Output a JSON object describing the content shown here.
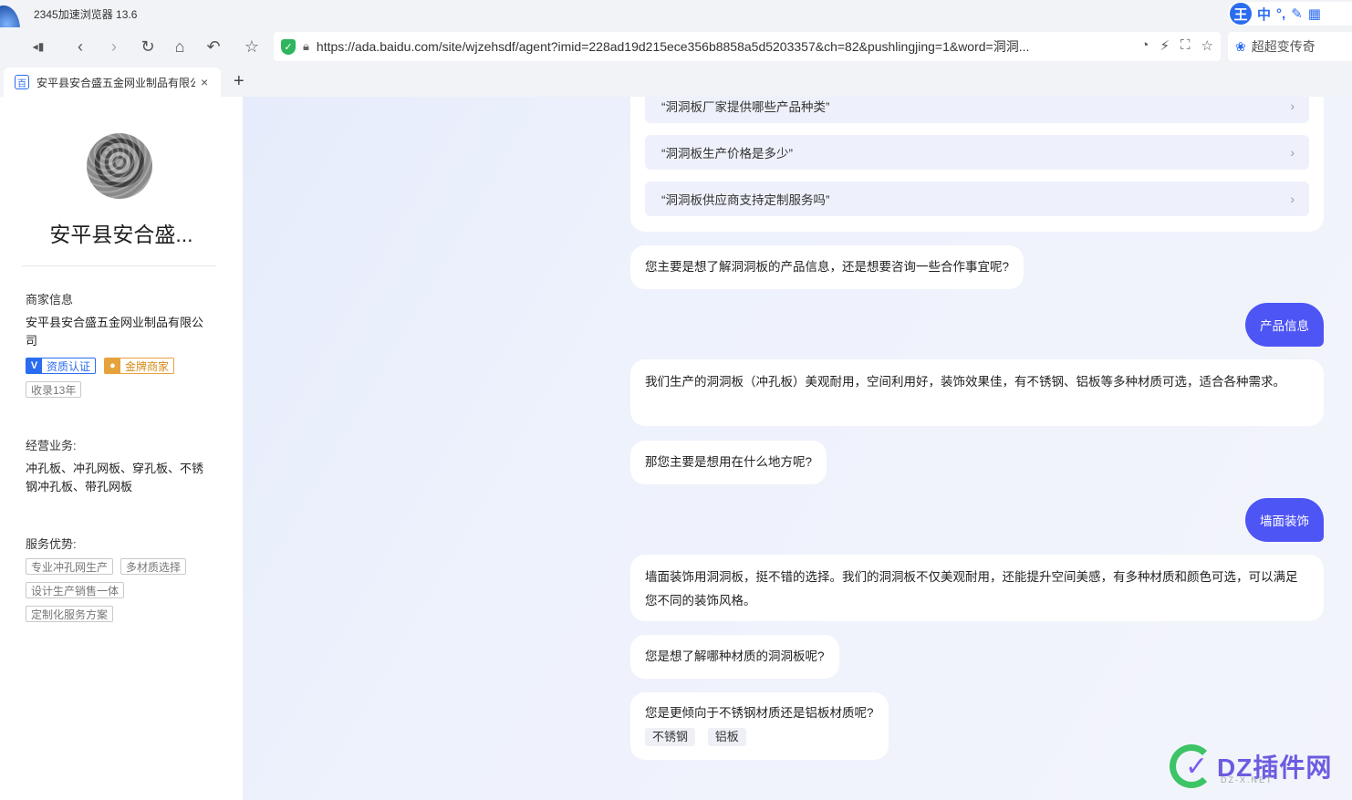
{
  "browser": {
    "title": "2345加速浏览器 13.6",
    "ime": {
      "logo": "王",
      "mode": "中"
    },
    "url": "https://ada.baidu.com/site/wjzehsdf/agent?imid=228ad19d215ece356b8858a5d5203357&ch=82&pushlingjing=1&word=洞洞...",
    "search_placeholder": "超超变传奇",
    "tab_title": "安平县安合盛五金网业制品有限公司",
    "new_tab": "+",
    "tab_close": "×"
  },
  "sidebar": {
    "shop_name": "安平县安合盛...",
    "merchant_label": "商家信息",
    "merchant_name": "安平县安合盛五金网业制品有限公司",
    "badges": [
      {
        "icon": "V",
        "text": "资质认证",
        "color": "#2a6cf0"
      },
      {
        "icon": "●",
        "text": "金牌商家",
        "color": "#e6a23c"
      }
    ],
    "years_tag": "收录13年",
    "business_label": "经营业务:",
    "business_text": "冲孔板、冲孔网板、穿孔板、不锈钢冲孔板、带孔网板",
    "advantages_label": "服务优势:",
    "advantages": [
      "专业冲孔网生产",
      "多材质选择",
      "设计生产销售一体",
      "定制化服务方案"
    ]
  },
  "chat": {
    "suggestions": [
      "“洞洞板厂家提供哪些产品种类”",
      "“洞洞板生产价格是多少”",
      "“洞洞板供应商支持定制服务吗”"
    ],
    "messages": [
      {
        "role": "bot",
        "text": "您主要是想了解洞洞板的产品信息，还是想要咨询一些合作事宜呢?"
      },
      {
        "role": "user",
        "text": "产品信息"
      },
      {
        "role": "bot",
        "text": "我们生产的洞洞板（冲孔板）美观耐用，空间利用好，装饰效果佳，有不锈钢、铝板等多种材质可选，适合各种需求。"
      },
      {
        "role": "bot",
        "text": "那您主要是想用在什么地方呢?"
      },
      {
        "role": "user",
        "text": "墙面装饰"
      },
      {
        "role": "bot",
        "text": "墙面装饰用洞洞板，挺不错的选择。我们的洞洞板不仅美观耐用，还能提升空间美感，有多种材质和颜色可选，可以满足您不同的装饰风格。"
      },
      {
        "role": "bot",
        "text": "您是想了解哪种材质的洞洞板呢?"
      },
      {
        "role": "bot",
        "text": "您是更倾向于不锈钢材质还是铝板材质呢?",
        "options": [
          "不锈钢",
          "铝板"
        ]
      }
    ]
  },
  "watermark": {
    "text": "DZ插件网",
    "sub": "DZ-X.NET"
  },
  "colors": {
    "accent": "#4e55f5",
    "verify": "#2a6cf0",
    "gold": "#e6a23c"
  }
}
